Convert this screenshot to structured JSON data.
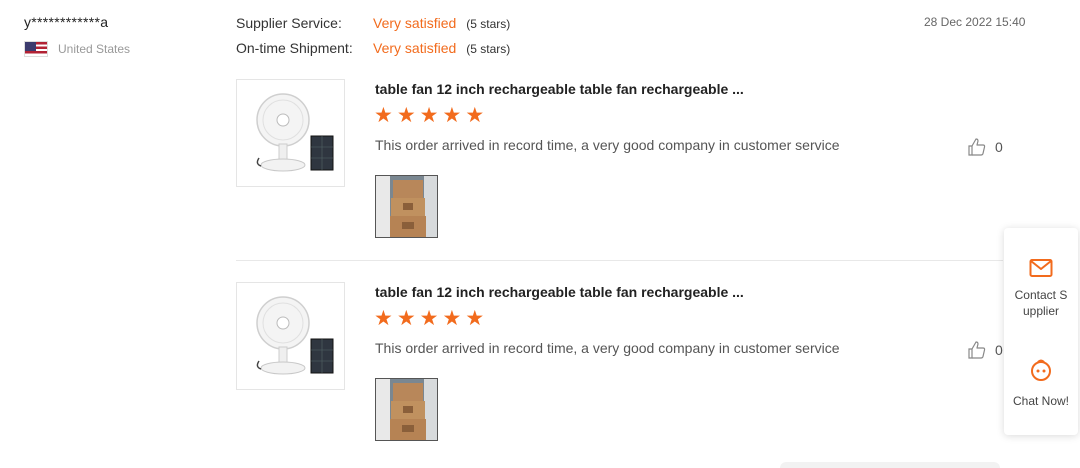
{
  "reviewer": {
    "name": "y************a",
    "country": "United States",
    "flag_icon": "us-flag-icon"
  },
  "ratings": [
    {
      "label": "Supplier Service:",
      "value": "Very satisfied",
      "stars": "(5 stars)"
    },
    {
      "label": "On-time Shipment:",
      "value": "Very satisfied",
      "stars": "(5 stars)"
    }
  ],
  "date": "28 Dec 2022 15:40",
  "reviews": [
    {
      "product_title": "table fan 12 inch rechargeable table fan rechargeable ...",
      "star_rating": 5,
      "comment": "This order arrived in record time, a very good company in customer service",
      "like_count": "0"
    },
    {
      "product_title": "table fan 12 inch rechargeable table fan rechargeable ...",
      "star_rating": 5,
      "comment": "This order arrived in record time, a very good company in customer service",
      "like_count": "0"
    }
  ],
  "side_panel": {
    "contact_label": "Contact Supplier",
    "chat_label": "Chat Now!"
  },
  "colors": {
    "accent": "#f26b1d",
    "text": "#333333",
    "muted": "#999999"
  }
}
